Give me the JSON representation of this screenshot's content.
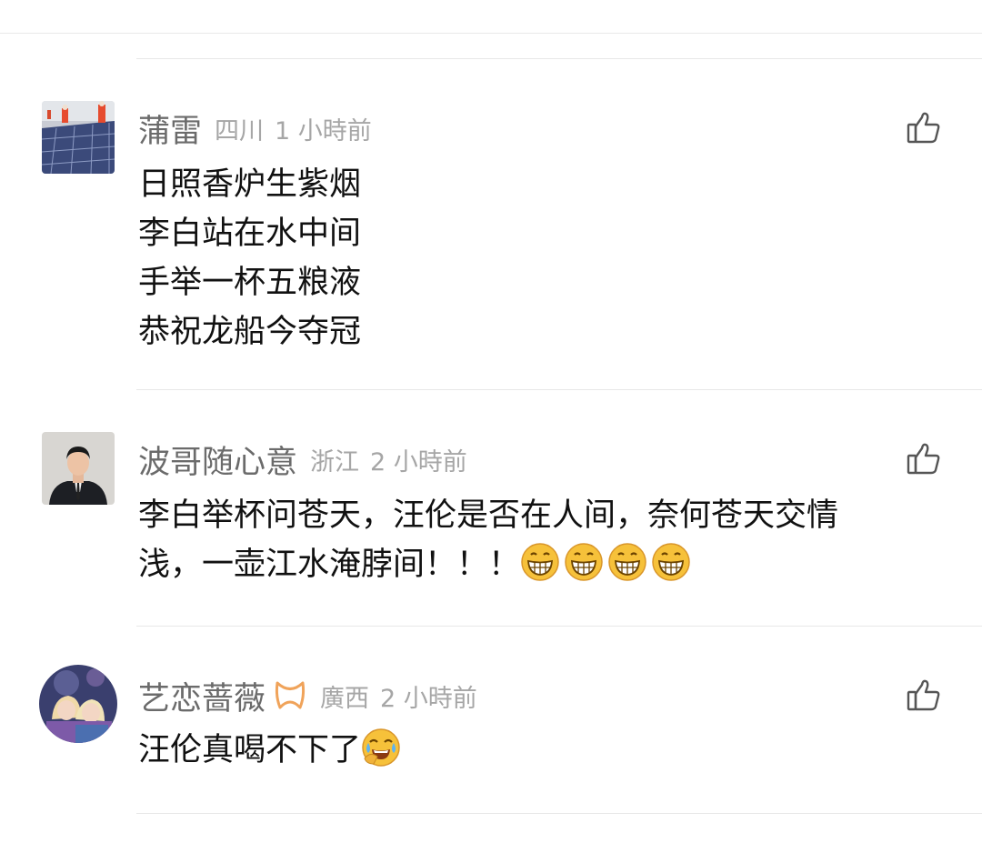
{
  "comments": [
    {
      "username": "蒲雷",
      "region": "四川",
      "time": "1 小時前",
      "lines": [
        "日照香炉生紫烟",
        "李白站在水中间",
        "手举一杯五粮液",
        "恭祝龙船今夺冠"
      ]
    },
    {
      "username": "波哥随心意",
      "region": "浙江",
      "time": "2 小時前",
      "lines": [
        "李白举杯问苍天，汪伦是否在人间，奈何苍天交情",
        "浅，一壶江水淹脖间！！！"
      ],
      "emojis": [
        "grin-emoji",
        "grin-emoji",
        "grin-emoji",
        "grin-emoji"
      ]
    },
    {
      "username": "艺恋蔷薇",
      "region": "廣西",
      "time": "2 小時前",
      "lines": [
        "汪伦真喝不下了"
      ],
      "emojis": [
        "laugh-cry-emoji"
      ]
    }
  ],
  "icons": {
    "like": "thumbs-up-icon",
    "badge": "ribbon-badge-icon"
  },
  "colors": {
    "username": "#6b6b6b",
    "meta": "#a6a6a6",
    "text": "#111111",
    "divider": "#e8e8e8",
    "badge": "#f0a35a"
  }
}
